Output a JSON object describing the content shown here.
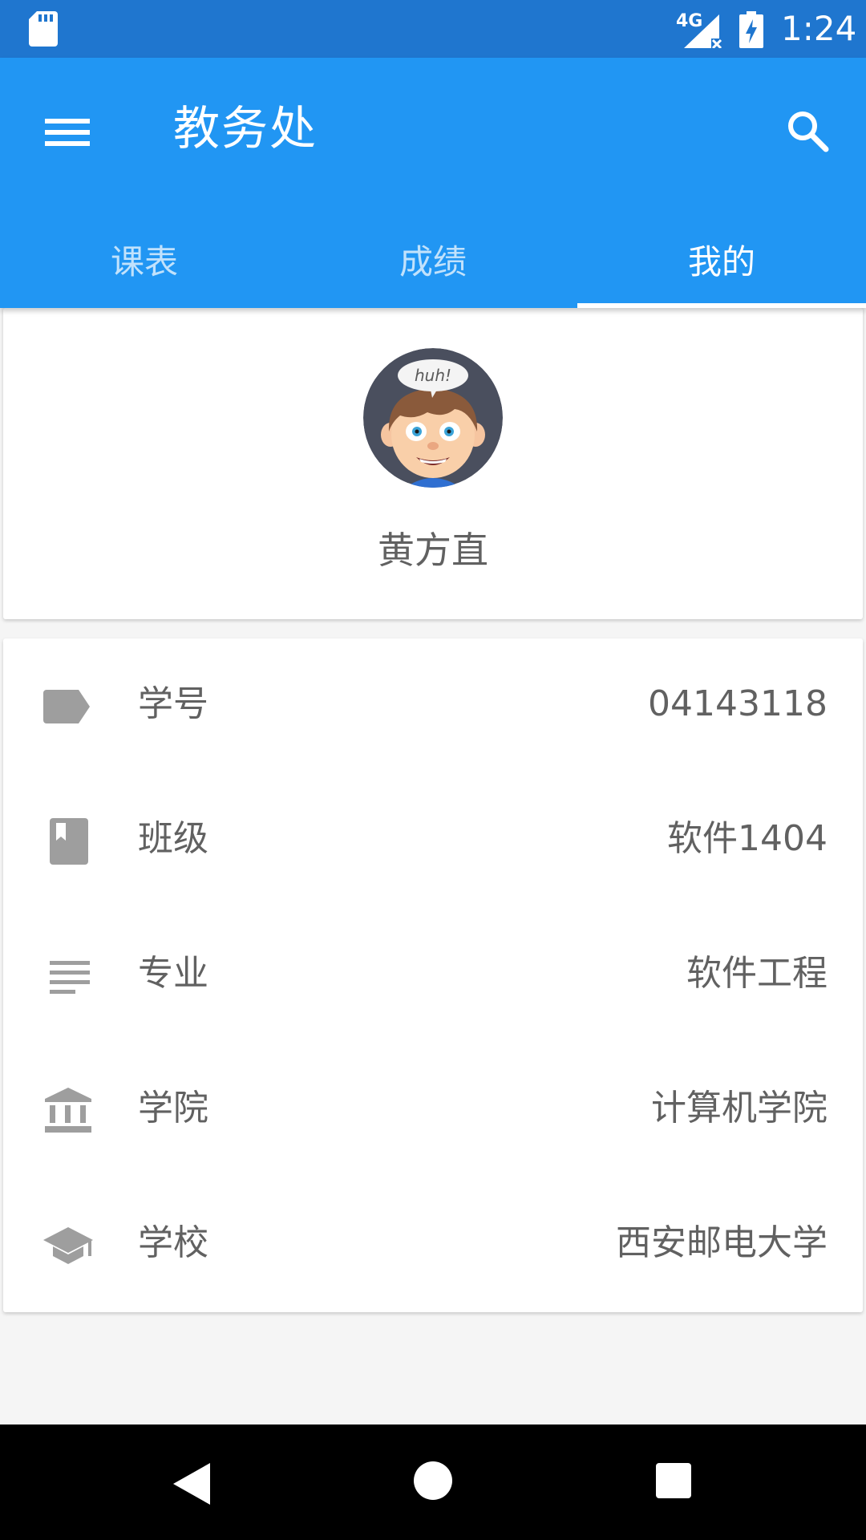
{
  "status_bar": {
    "network": "4G",
    "time": "1:24"
  },
  "app_bar": {
    "title": "教务处"
  },
  "tabs": [
    {
      "label": "课表",
      "active": false
    },
    {
      "label": "成绩",
      "active": false
    },
    {
      "label": "我的",
      "active": true
    }
  ],
  "profile": {
    "avatar_text": "huh!",
    "name": "黄方直"
  },
  "info_rows": [
    {
      "icon": "label-tag-icon",
      "label": "学号",
      "value": "04143118"
    },
    {
      "icon": "book-icon",
      "label": "班级",
      "value": "软件1404"
    },
    {
      "icon": "subject-lines-icon",
      "label": "专业",
      "value": "软件工程"
    },
    {
      "icon": "institution-icon",
      "label": "学院",
      "value": "计算机学院"
    },
    {
      "icon": "graduation-cap-icon",
      "label": "学校",
      "value": "西安邮电大学"
    }
  ],
  "colors": {
    "status_bar": "#1f76cf",
    "primary": "#2196f3",
    "icon_gray": "#9e9e9e",
    "text_gray": "#616161",
    "background": "#f5f5f5"
  }
}
